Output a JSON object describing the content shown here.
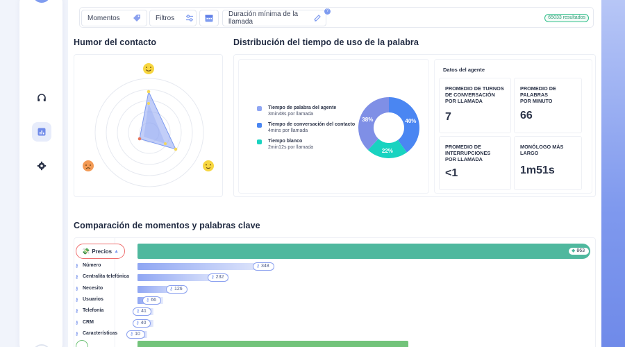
{
  "filters": {
    "moments_label": "Momentos",
    "filters_label": "Filtros",
    "duration_label": "Duración mínima de la llamada",
    "help_mark": "?",
    "results": "65033 resultados"
  },
  "mood": {
    "title": "Humor del contacto"
  },
  "distribution": {
    "title": "Distribución del tiempo de uso de la palabra",
    "legend": [
      {
        "label": "Tiempo de palabra del agente",
        "detail": "3min48s por llamada",
        "color": "#8fa6f3"
      },
      {
        "label": "Tiempo de conversación del contacto",
        "detail": "4mins por llamada",
        "color": "#4a86f2"
      },
      {
        "label": "Tiempo blanco",
        "detail": "2min12s por llamada",
        "color": "#19d3c0"
      }
    ],
    "chart_data": {
      "type": "pie",
      "categories": [
        "Tiempo de palabra del agente",
        "Tiempo de conversación del contacto",
        "Tiempo blanco"
      ],
      "values": [
        38,
        40,
        22
      ],
      "labels": [
        "38%",
        "40%",
        "22%"
      ],
      "colors": [
        "#7f8fe6",
        "#4a86f2",
        "#19d3c0"
      ]
    }
  },
  "agent": {
    "title": "Datos del agente",
    "stats": [
      {
        "label_lines": [
          "PROMEDIO DE TURNOS",
          "DE CONVERSACIÓN",
          "POR LLAMADA"
        ],
        "value": "7"
      },
      {
        "label_lines": [
          "PROMEDIO DE",
          "PALABRAS",
          "POR MINUTO"
        ],
        "value": "66"
      },
      {
        "label_lines": [
          "PROMEDIO DE",
          "INTERRUPCIONES",
          "POR LLAMADA"
        ],
        "value": "<1"
      },
      {
        "label_lines": [
          "MONÓLOGO MÁS",
          "LARGO"
        ],
        "value": "1m51s"
      }
    ]
  },
  "comparison": {
    "title": "Comparación de momentos y palabras clave",
    "category": {
      "label": "Precios",
      "count": "863",
      "fraction": 1.0,
      "color": "#4fb89e"
    },
    "second_category": {
      "count": "???",
      "color": "#72c37a"
    },
    "chart_data": {
      "type": "bar",
      "categories": [
        "Número",
        "Centralita telefónica",
        "Necesito",
        "Usuarios",
        "Telefonía",
        "CRM",
        "Características"
      ],
      "values": [
        348,
        232,
        126,
        66,
        41,
        40,
        10
      ],
      "value_labels": [
        "348",
        "232",
        "126",
        "66",
        "41",
        "40",
        "10"
      ],
      "parent_category": "Precios",
      "parent_value": 863
    }
  },
  "icons": {
    "sidebar": [
      "headset-icon",
      "chart-icon",
      "gear-icon"
    ],
    "accent": "#7f9cf0"
  }
}
